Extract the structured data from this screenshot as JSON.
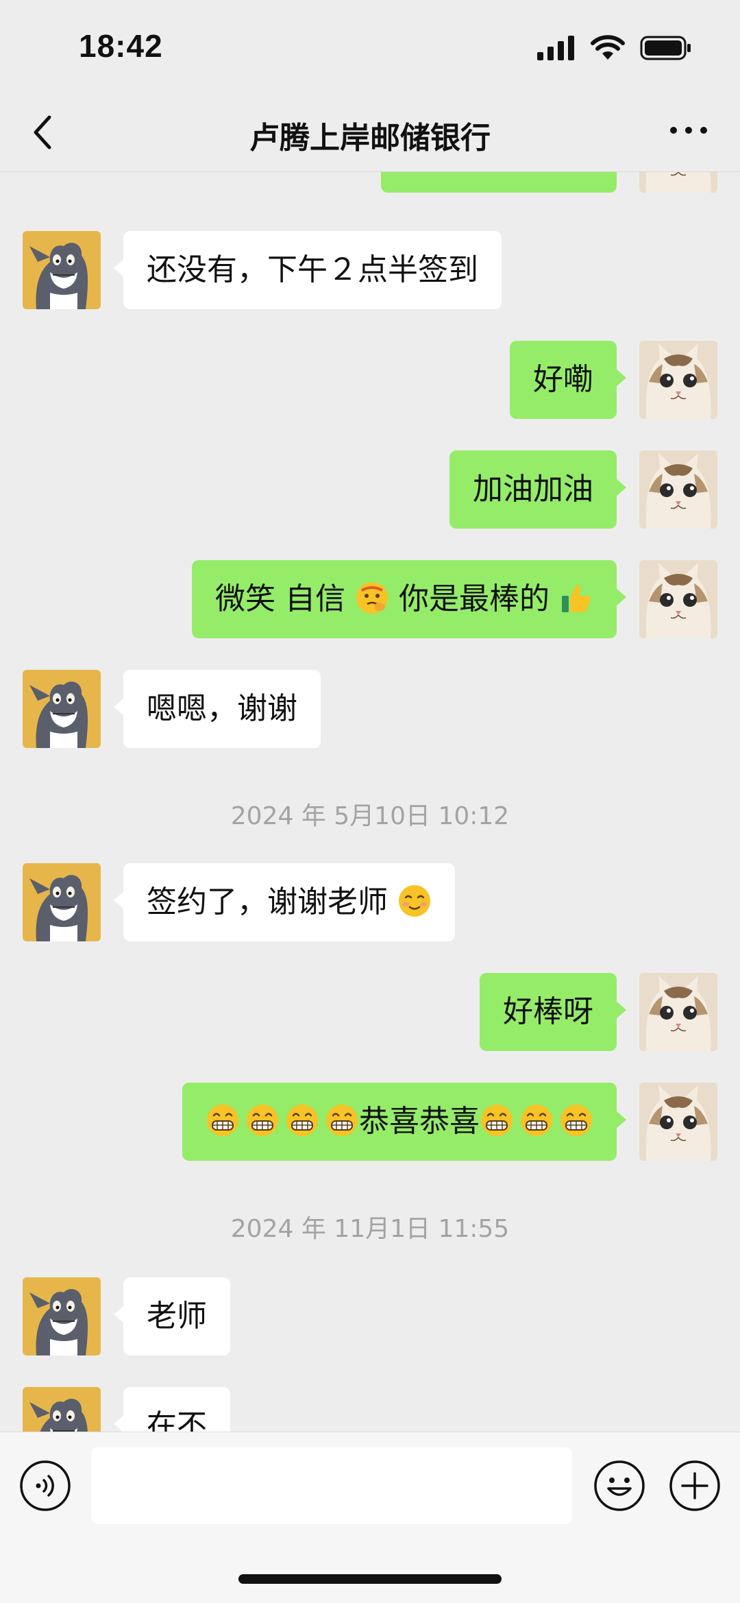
{
  "status_bar": {
    "time": "18:42"
  },
  "header": {
    "title": "卢腾上岸邮储银行"
  },
  "messages": [
    {
      "side": "left",
      "text": "还没有，下午２点半签到"
    },
    {
      "side": "right",
      "text": "好嘞"
    },
    {
      "side": "right",
      "text": "加油加油"
    },
    {
      "side": "right",
      "text": "微笑 自信",
      "text2": "你是最棒的",
      "emoji1": "thinking-face-emoji",
      "emoji2": "thumbs-up-emoji"
    },
    {
      "side": "left",
      "text": "嗯嗯，谢谢"
    },
    {
      "side": "left",
      "text": "签约了，谢谢老师",
      "emoji1": "smiling-face-emoji"
    },
    {
      "side": "right",
      "text": "好棒呀"
    },
    {
      "side": "right",
      "text": "恭喜恭喜",
      "emoji_before_count": 4,
      "emoji_after_count": 3,
      "emoji": "grinning-face-emoji"
    },
    {
      "side": "left",
      "text": "老师"
    },
    {
      "side": "left",
      "text": "在不"
    }
  ],
  "timestamps": [
    "2024 年 5月10日 10:12",
    "2024 年 11月1日 11:55"
  ],
  "colors": {
    "my_bubble": "#95ec69",
    "their_bubble": "#ffffff",
    "background": "#ededed"
  },
  "icons": [
    "back-icon",
    "more-icon",
    "voice-icon",
    "emoji-icon",
    "plus-icon"
  ]
}
